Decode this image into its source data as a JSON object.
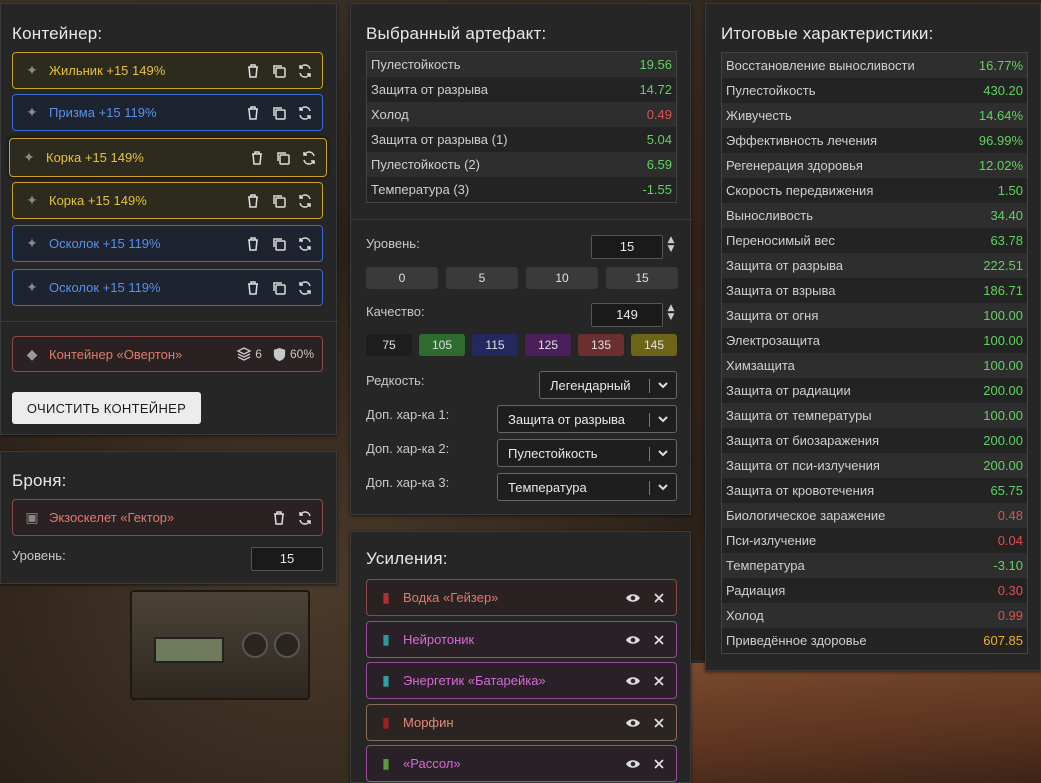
{
  "container": {
    "title": "Контейнер:",
    "items": [
      {
        "label": "Жильник +15 149%",
        "rarity": "gold",
        "icon": "artifact-zhilnik-icon"
      },
      {
        "label": "Призма +15 119%",
        "rarity": "blue",
        "icon": "artifact-prizma-icon"
      },
      {
        "label": "Корка +15 149%",
        "rarity": "gold",
        "icon": "artifact-korka-icon"
      },
      {
        "label": "Корка +15 149%",
        "rarity": "gold",
        "icon": "artifact-korka-icon"
      },
      {
        "label": "Осколок +15 119%",
        "rarity": "blue",
        "icon": "artifact-oskolok-icon"
      },
      {
        "label": "Осколок +15 119%",
        "rarity": "blue",
        "icon": "artifact-oskolok-icon"
      }
    ],
    "container_name": "Контейнер «Овертон»",
    "slots": "6",
    "protection": "60%",
    "clear_button": "ОЧИСТИТЬ КОНТЕЙНЕР"
  },
  "armor": {
    "title": "Броня:",
    "item": "Экзоскелет «Гектор»",
    "level_label": "Уровень:",
    "level_value": "15"
  },
  "artifact": {
    "title": "Выбранный артефакт:",
    "stats": [
      {
        "name": "Пулестойкость",
        "value": "19.56",
        "color": "green"
      },
      {
        "name": "Защита от разрыва",
        "value": "14.72",
        "color": "green"
      },
      {
        "name": "Холод",
        "value": "0.49",
        "color": "red"
      },
      {
        "name": "Защита от разрыва (1)",
        "value": "5.04",
        "color": "green"
      },
      {
        "name": "Пулестойкость (2)",
        "value": "6.59",
        "color": "green"
      },
      {
        "name": "Температура (3)",
        "value": "-1.55",
        "color": "green"
      }
    ],
    "level_label": "Уровень:",
    "level_value": "15",
    "level_presets": [
      "0",
      "5",
      "10",
      "15"
    ],
    "quality_label": "Качество:",
    "quality_value": "149",
    "quality_presets": [
      {
        "label": "75",
        "color": "#1e1e1e"
      },
      {
        "label": "105",
        "color": "#2e6b2e"
      },
      {
        "label": "115",
        "color": "#23285e"
      },
      {
        "label": "125",
        "color": "#4a1f5a"
      },
      {
        "label": "135",
        "color": "#6a3030"
      },
      {
        "label": "145",
        "color": "#6e6418"
      }
    ],
    "rarity_label": "Редкость:",
    "rarity_value": "Легендарный",
    "extra1_label": "Доп. хар-ка 1:",
    "extra1_value": "Защита от разрыва",
    "extra2_label": "Доп. хар-ка 2:",
    "extra2_value": "Пулестойкость",
    "extra3_label": "Доп. хар-ка 3:",
    "extra3_value": "Температура"
  },
  "boosts": {
    "title": "Усиления:",
    "items": [
      {
        "label": "Водка «Гейзер»",
        "style": "red",
        "icon": "bottle-icon"
      },
      {
        "label": "Нейротоник",
        "style": "purple",
        "icon": "vial-icon"
      },
      {
        "label": "Энергетик «Батарейка»",
        "style": "purple",
        "icon": "injector-icon"
      },
      {
        "label": "Морфин",
        "style": "brown",
        "icon": "syringe-icon"
      },
      {
        "label": "«Рассол»",
        "style": "purple",
        "icon": "jar-icon"
      }
    ]
  },
  "totals": {
    "title": "Итоговые характеристики:",
    "stats": [
      {
        "name": "Восстановление выносливости",
        "value": "16.77%",
        "color": "green"
      },
      {
        "name": "Пулестойкость",
        "value": "430.20",
        "color": "green"
      },
      {
        "name": "Живучесть",
        "value": "14.64%",
        "color": "green"
      },
      {
        "name": "Эффективность лечения",
        "value": "96.99%",
        "color": "green"
      },
      {
        "name": "Регенерация здоровья",
        "value": "12.02%",
        "color": "green"
      },
      {
        "name": "Скорость передвижения",
        "value": "1.50",
        "color": "green"
      },
      {
        "name": "Выносливость",
        "value": "34.40",
        "color": "green"
      },
      {
        "name": "Переносимый вес",
        "value": "63.78",
        "color": "green"
      },
      {
        "name": "Защита от разрыва",
        "value": "222.51",
        "color": "green"
      },
      {
        "name": "Защита от взрыва",
        "value": "186.71",
        "color": "green"
      },
      {
        "name": "Защита от огня",
        "value": "100.00",
        "color": "green"
      },
      {
        "name": "Электрозащита",
        "value": "100.00",
        "color": "green"
      },
      {
        "name": "Химзащита",
        "value": "100.00",
        "color": "green"
      },
      {
        "name": "Защита от радиации",
        "value": "200.00",
        "color": "green"
      },
      {
        "name": "Защита от температуры",
        "value": "100.00",
        "color": "green"
      },
      {
        "name": "Защита от биозаражения",
        "value": "200.00",
        "color": "green"
      },
      {
        "name": "Защита от пси-излучения",
        "value": "200.00",
        "color": "green"
      },
      {
        "name": "Защита от кровотечения",
        "value": "65.75",
        "color": "green"
      },
      {
        "name": "Биологическое заражение",
        "value": "0.48",
        "color": "red"
      },
      {
        "name": "Пси-излучение",
        "value": "0.04",
        "color": "red"
      },
      {
        "name": "Температура",
        "value": "-3.10",
        "color": "green"
      },
      {
        "name": "Радиация",
        "value": "0.30",
        "color": "red"
      },
      {
        "name": "Холод",
        "value": "0.99",
        "color": "red"
      },
      {
        "name": "Приведённое здоровье",
        "value": "607.85",
        "color": "gold"
      }
    ]
  }
}
